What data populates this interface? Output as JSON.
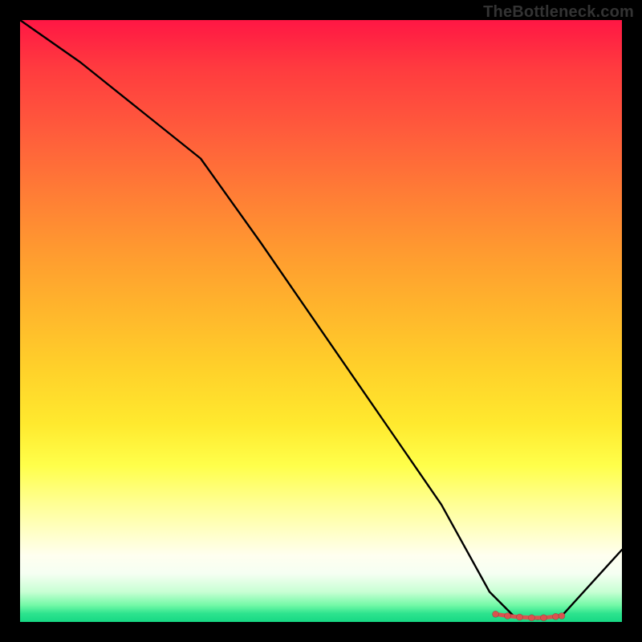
{
  "watermark": "TheBottleneck.com",
  "colors": {
    "page_bg": "#000000",
    "gradient_top": "#ff1744",
    "gradient_bottom": "#17d884",
    "curve": "#000000",
    "marker": "#d9534f"
  },
  "chart_data": {
    "type": "line",
    "title": "",
    "xlabel": "",
    "ylabel": "",
    "xlim": [
      0,
      100
    ],
    "ylim": [
      0,
      100
    ],
    "grid": false,
    "legend": false,
    "series": [
      {
        "name": "curve",
        "x": [
          0,
          10,
          20,
          30,
          40,
          50,
          60,
          70,
          78,
          82,
          86,
          90,
          100
        ],
        "y": [
          100,
          93,
          85,
          77,
          63,
          48.5,
          34,
          19.5,
          5,
          1,
          0.5,
          1,
          12
        ]
      }
    ],
    "markers": {
      "name": "highlight",
      "x": [
        79,
        81,
        83,
        85,
        87,
        89,
        90
      ],
      "y": [
        1.3,
        1.0,
        0.8,
        0.7,
        0.7,
        0.9,
        1.0
      ]
    },
    "note": "Axes unlabeled in source; x/y expressed as 0–100 percent of plot area (y=0 at bottom)."
  }
}
